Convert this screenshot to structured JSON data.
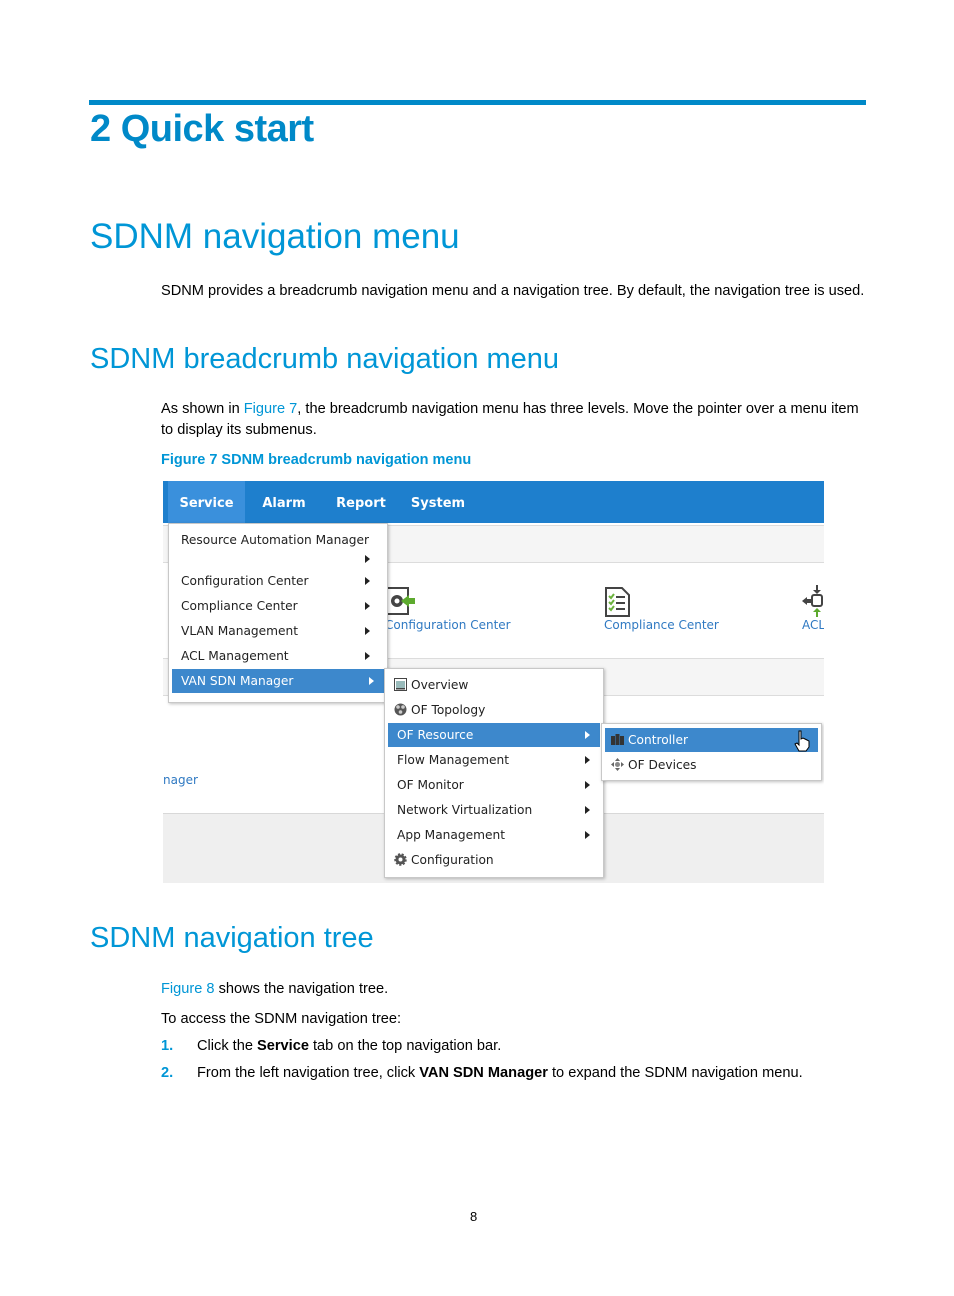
{
  "chapter_title": "2 Quick start",
  "section_title": "SDNM navigation menu",
  "intro_paragraph": "SDNM provides a breadcrumb navigation menu and a navigation tree. By default, the navigation tree is used.",
  "breadcrumb_section": {
    "title": "SDNM breadcrumb navigation menu",
    "para_prefix": "As shown in ",
    "para_link": "Figure 7",
    "para_suffix": ", the breadcrumb navigation menu has three levels. Move the pointer over a menu item to display its submenus.",
    "figure_caption": "Figure 7 SDNM breadcrumb navigation menu"
  },
  "figure": {
    "nav_tabs": [
      "Service",
      "Alarm",
      "Report",
      "System"
    ],
    "active_tab": "Service",
    "background_links": {
      "configuration_center": "Configuration Center",
      "compliance_center": "Compliance Center",
      "acl": "ACL",
      "partial_manager": "nager"
    },
    "service_menu": [
      {
        "label": "Resource Automation Manager",
        "has_submenu": true
      },
      {
        "label": "Configuration Center",
        "has_submenu": true
      },
      {
        "label": "Compliance Center",
        "has_submenu": true
      },
      {
        "label": "VLAN Management",
        "has_submenu": true
      },
      {
        "label": "ACL Management",
        "has_submenu": true
      },
      {
        "label": "VAN SDN Manager",
        "has_submenu": true,
        "selected": true
      }
    ],
    "sdn_menu": [
      {
        "label": "Overview",
        "icon": "overview-icon"
      },
      {
        "label": "OF Topology",
        "icon": "topology-icon"
      },
      {
        "label": "OF Resource",
        "has_submenu": true,
        "selected": true
      },
      {
        "label": "Flow Management",
        "has_submenu": true
      },
      {
        "label": "OF Monitor",
        "has_submenu": true
      },
      {
        "label": "Network Virtualization",
        "has_submenu": true
      },
      {
        "label": "App Management",
        "has_submenu": true
      },
      {
        "label": "Configuration",
        "icon": "gear-icon"
      }
    ],
    "resource_menu": [
      {
        "label": "Controller",
        "icon": "controller-icon",
        "selected": true
      },
      {
        "label": "OF Devices",
        "icon": "of-devices-icon"
      }
    ],
    "colors": {
      "navbar": "#1e7fcd",
      "selected": "#3d88cc",
      "link": "#2f79c2"
    }
  },
  "tree_section": {
    "title": "SDNM navigation tree",
    "para_link": "Figure 8",
    "para_suffix": " shows the navigation tree.",
    "access_intro": "To access the SDNM navigation tree:",
    "steps": [
      {
        "num": "1.",
        "pre": "Click the ",
        "bold": "Service",
        "post": " tab on the top navigation bar."
      },
      {
        "num": "2.",
        "pre": "From the left navigation tree, click ",
        "bold": "VAN SDN Manager",
        "post": " to expand the SDNM navigation menu."
      }
    ]
  },
  "page_number": "8",
  "colors": {
    "heading": "#0096d6",
    "rule": "#0089c8"
  }
}
